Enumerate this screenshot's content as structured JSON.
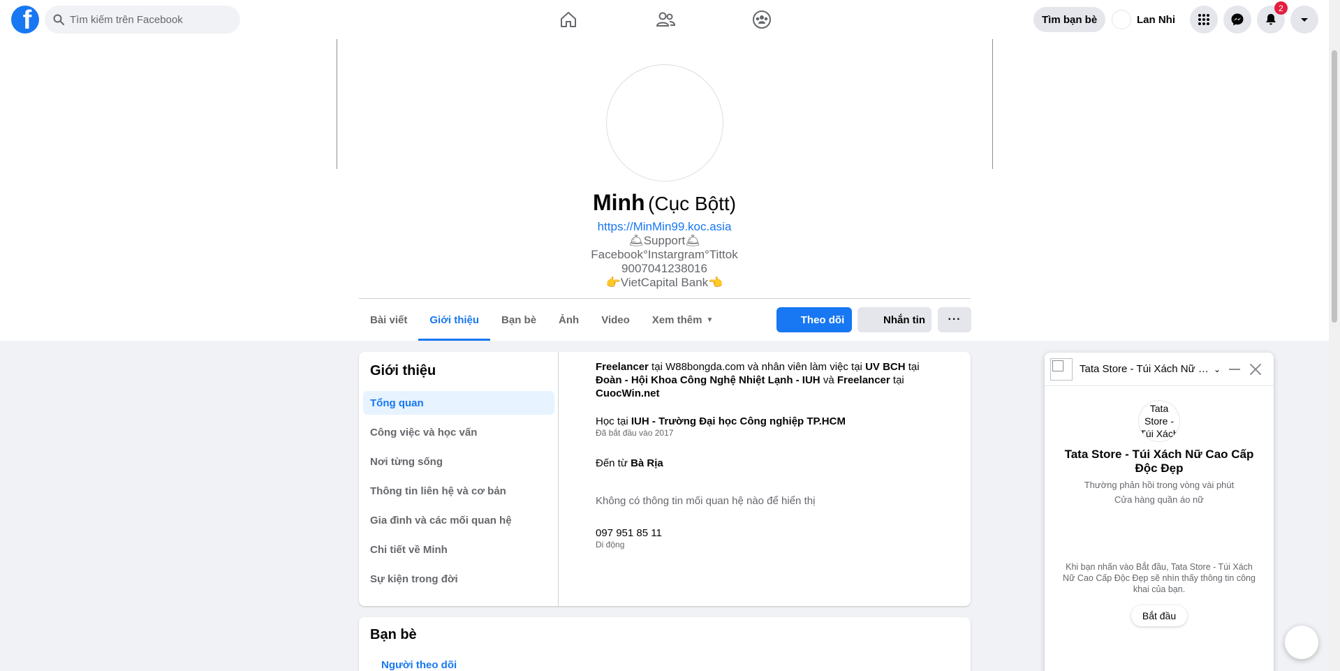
{
  "colors": {
    "accent": "#1877f2",
    "badge": "#e41e3f",
    "nav_active_bg": "#e7f3ff"
  },
  "topbar": {
    "logo_letter": "f",
    "search_placeholder": "Tìm kiếm trên Facebook",
    "nav_icons": [
      "home-icon",
      "friends-icon",
      "groups-icon"
    ],
    "find_friends_label": "Tìm bạn bè",
    "user_name": "Lan Nhi",
    "notification_count": "2"
  },
  "profile": {
    "name": "Minh",
    "alt_name": "(Cục Bộtt)",
    "bio_link": "https://MinMin99.koc.asia",
    "bio_lines": [
      "🛎Support🛎",
      "Facebook°Instargram°Tittok",
      "9007041238016",
      "👉VietCapital Bank👈"
    ]
  },
  "tabs": [
    {
      "label": "Bài viết",
      "active": false
    },
    {
      "label": "Giới thiệu",
      "active": true
    },
    {
      "label": "Bạn bè",
      "active": false
    },
    {
      "label": "Ảnh",
      "active": false
    },
    {
      "label": "Video",
      "active": false
    },
    {
      "label": "Xem thêm",
      "active": false
    }
  ],
  "actions": {
    "follow": "Theo dõi",
    "message": "Nhắn tin",
    "more": "···"
  },
  "about": {
    "title": "Giới thiệu",
    "nav": [
      {
        "label": "Tổng quan",
        "active": true
      },
      {
        "label": "Công việc và học vấn",
        "active": false
      },
      {
        "label": "Nơi từng sống",
        "active": false
      },
      {
        "label": "Thông tin liên hệ và cơ bản",
        "active": false
      },
      {
        "label": "Gia đình và các mối quan hệ",
        "active": false
      },
      {
        "label": "Chi tiết về Minh",
        "active": false
      },
      {
        "label": "Sự kiện trong đời",
        "active": false
      }
    ],
    "work": {
      "w1": "Freelancer",
      "t1": " tại W88bongda.com và nhân viên làm việc tại ",
      "w2": "UV BCH",
      "t2": " tại ",
      "w3": "Đoàn - Hội Khoa Công Nghệ Nhiệt Lạnh - IUH",
      "t3": " và ",
      "w4": "Freelancer",
      "t4": " tại ",
      "w5": "CuocWin.net"
    },
    "education": {
      "prefix": "Học tại ",
      "school": "IUH - Trường Đại học Công nghiệp TP.HCM",
      "sub": "Đã bắt đầu vào 2017"
    },
    "hometown": {
      "prefix": "Đến từ ",
      "place": "Bà Rịa"
    },
    "relationship": "Không có thông tin mối quan hệ nào để hiển thị",
    "phone": {
      "number": "097 951 85 11",
      "sub": "Di động"
    }
  },
  "friends": {
    "title": "Bạn bè",
    "followers_link": "Người theo dõi"
  },
  "chat": {
    "header_title": "Tata Store - Túi Xách Nữ Cao Cấp Độc Đẹp",
    "avatar_alt": "Tata Store - Túi Xách",
    "name": "Tata Store - Túi Xách Nữ Cao Cấp Độc Đẹp",
    "response": "Thường phản hồi trong vòng vài phút",
    "category": "Cửa hàng quần áo nữ",
    "note": "Khi bạn nhấn vào Bắt đầu, Tata Store - Túi Xách Nữ Cao Cấp Độc Đẹp sẽ nhìn thấy thông tin công khai của bạn.",
    "start_label": "Bắt đầu"
  }
}
